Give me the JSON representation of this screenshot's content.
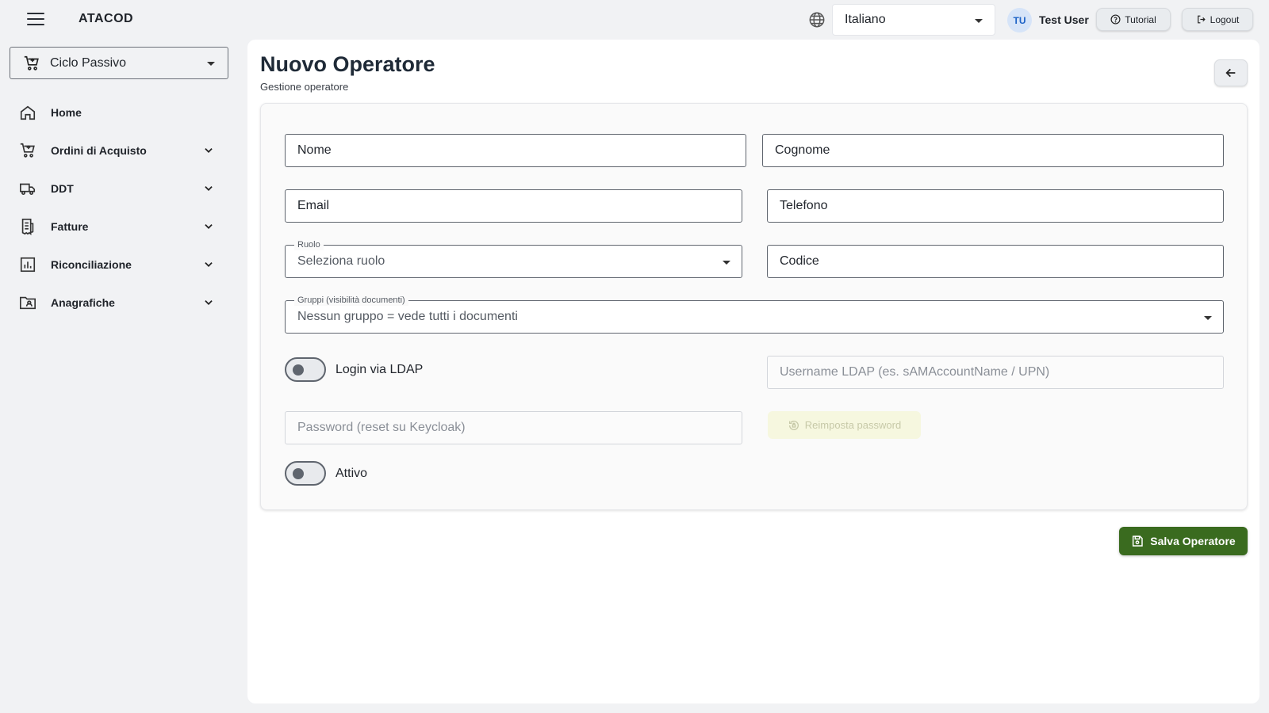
{
  "header": {
    "app_title": "ATACOD",
    "language": "Italiano",
    "user_initials": "TU",
    "user_name": "Test User",
    "tutorial_label": "Tutorial",
    "logout_label": "Logout"
  },
  "sidebar": {
    "module": "Ciclo Passivo",
    "items": [
      {
        "label": "Home",
        "icon": "home-icon",
        "expandable": false
      },
      {
        "label": "Ordini di Acquisto",
        "icon": "cart-icon",
        "expandable": true
      },
      {
        "label": "DDT",
        "icon": "truck-icon",
        "expandable": true
      },
      {
        "label": "Fatture",
        "icon": "invoice-icon",
        "expandable": true
      },
      {
        "label": "Riconciliazione",
        "icon": "chart-icon",
        "expandable": true
      },
      {
        "label": "Anagrafiche",
        "icon": "folder-user-icon",
        "expandable": true
      }
    ]
  },
  "page": {
    "title": "Nuovo Operatore",
    "subtitle": "Gestione operatore"
  },
  "form": {
    "nome": "Nome",
    "cognome": "Cognome",
    "email": "Email",
    "telefono": "Telefono",
    "ruolo_label": "Ruolo",
    "ruolo_placeholder": "Seleziona ruolo",
    "codice": "Codice",
    "gruppi_label": "Gruppi (visibilità documenti)",
    "gruppi_placeholder": "Nessun gruppo = vede tutti i documenti",
    "ldap_toggle_label": "Login via LDAP",
    "ldap_username_placeholder": "Username LDAP (es. sAMAccountName / UPN)",
    "password_placeholder": "Password (reset su Keycloak)",
    "reset_password_label": "Reimposta password",
    "attivo_label": "Attivo",
    "save_label": "Salva Operatore"
  },
  "colors": {
    "primary": "#3a6b1f",
    "avatar_bg": "#d6e4f8",
    "avatar_text": "#1e63c6"
  }
}
